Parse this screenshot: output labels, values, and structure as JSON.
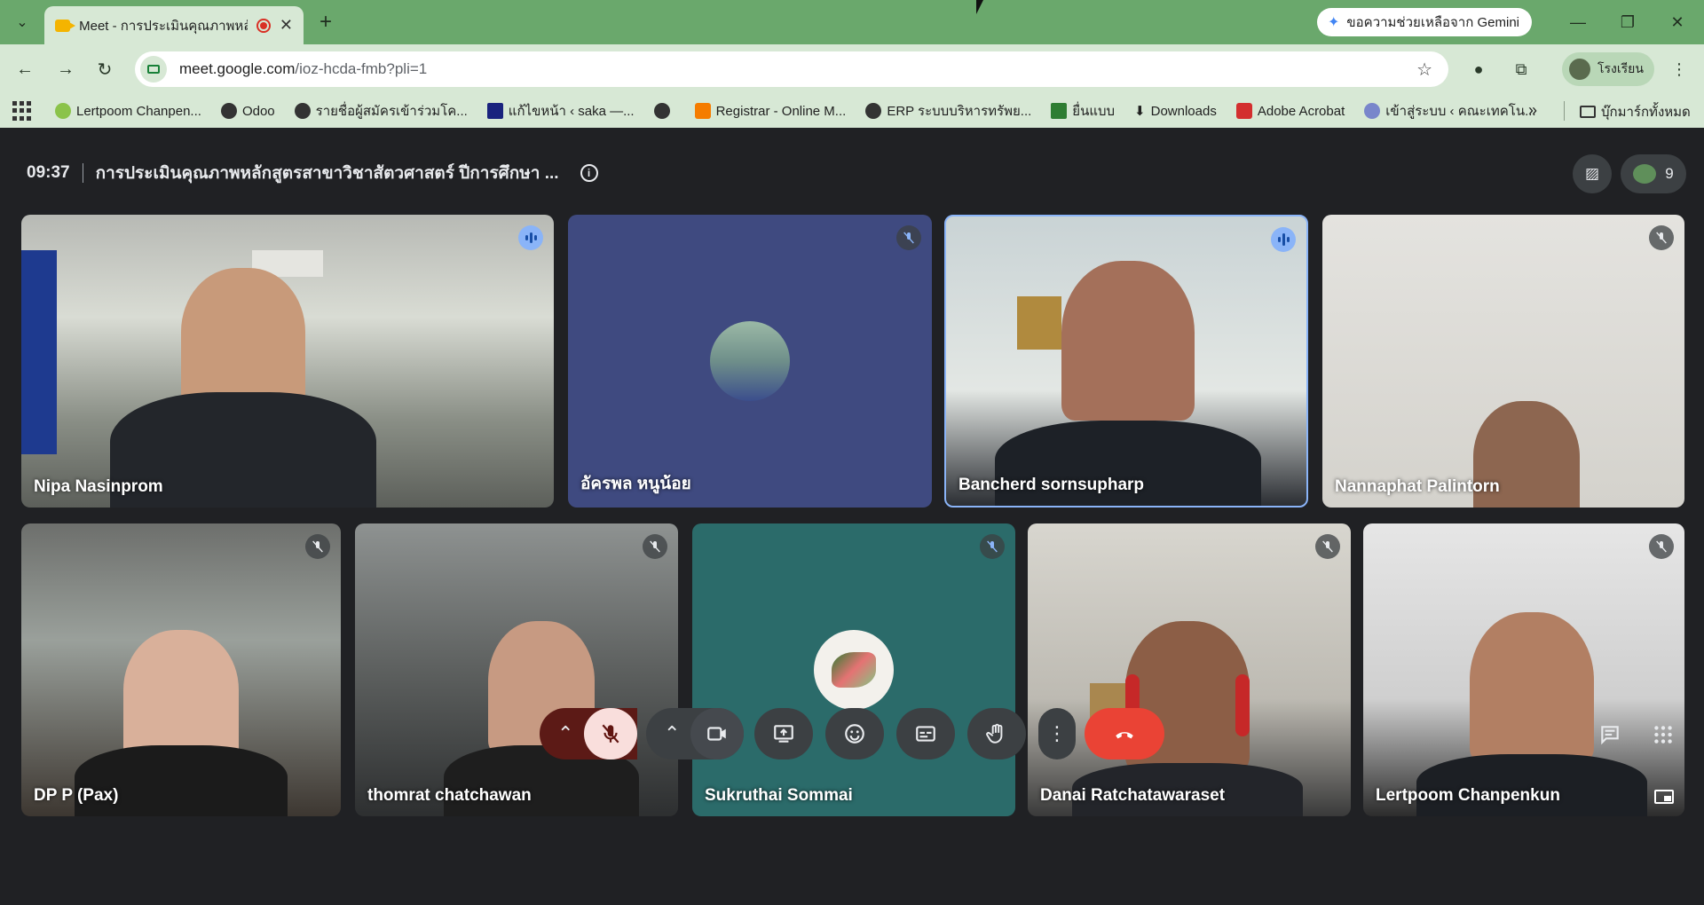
{
  "browser": {
    "tab_title": "Meet - การประเมินคุณภาพหลักสูตร",
    "gemini_label": "ขอความช่วยเหลือจาก Gemini",
    "url_host": "meet.google.com",
    "url_path": "/ioz-hcda-fmb?pli=1",
    "profile_label": "โรงเรียน",
    "bookmarks": [
      {
        "label": "Lertpoom Chanpen...",
        "color": "#8bc34a"
      },
      {
        "label": "Odoo",
        "color": "#333333"
      },
      {
        "label": "รายชื่อผู้สมัครเข้าร่วมโค...",
        "color": "#333333"
      },
      {
        "label": "แก้ไขหน้า ‹ saka —...",
        "color": "#1a237e"
      },
      {
        "label": "",
        "color": "#333333"
      },
      {
        "label": "Registrar - Online M...",
        "color": "#f57c00"
      },
      {
        "label": "ERP ระบบบริหารทรัพย...",
        "color": "#333333"
      },
      {
        "label": "ยื่นแบบ",
        "color": "#2e7d32"
      },
      {
        "label": "Downloads",
        "color": "#333333"
      },
      {
        "label": "Adobe Acrobat",
        "color": "#d32f2f"
      },
      {
        "label": "เข้าสู่ระบบ ‹ คณะเทคโน...",
        "color": "#7986cb"
      }
    ],
    "bookmarks_more": "»",
    "all_bookmarks": "บุ๊กมาร์กทั้งหมด"
  },
  "meeting": {
    "time": "09:37",
    "title": "การประเมินคุณภาพหลักสูตรสาขาวิชาสัตวศาสตร์ ปีการศึกษา ...",
    "participant_count": "9",
    "participants": [
      {
        "name": "Nipa Nasinprom",
        "status": "speaking"
      },
      {
        "name": "อัครพล หนูน้อย",
        "status": "muted"
      },
      {
        "name": "Bancherd sornsupharp",
        "status": "speaking"
      },
      {
        "name": "Nannaphat Palintorn",
        "status": "muted"
      },
      {
        "name": "DP P (Pax)",
        "status": "muted"
      },
      {
        "name": "thomrat chatchawan",
        "status": "muted"
      },
      {
        "name": "Sukruthai Sommai",
        "status": "muted"
      },
      {
        "name": "Danai Ratchatawaraset",
        "status": "muted"
      },
      {
        "name": "Lertpoom Chanpenkun",
        "status": "muted"
      }
    ]
  },
  "colors": {
    "chrome_green": "#6aa86c",
    "toolbar_green": "#d7e8d5",
    "meet_bg": "#202124",
    "end_call": "#ea4335",
    "mic_off_bg": "#f9dedc"
  }
}
